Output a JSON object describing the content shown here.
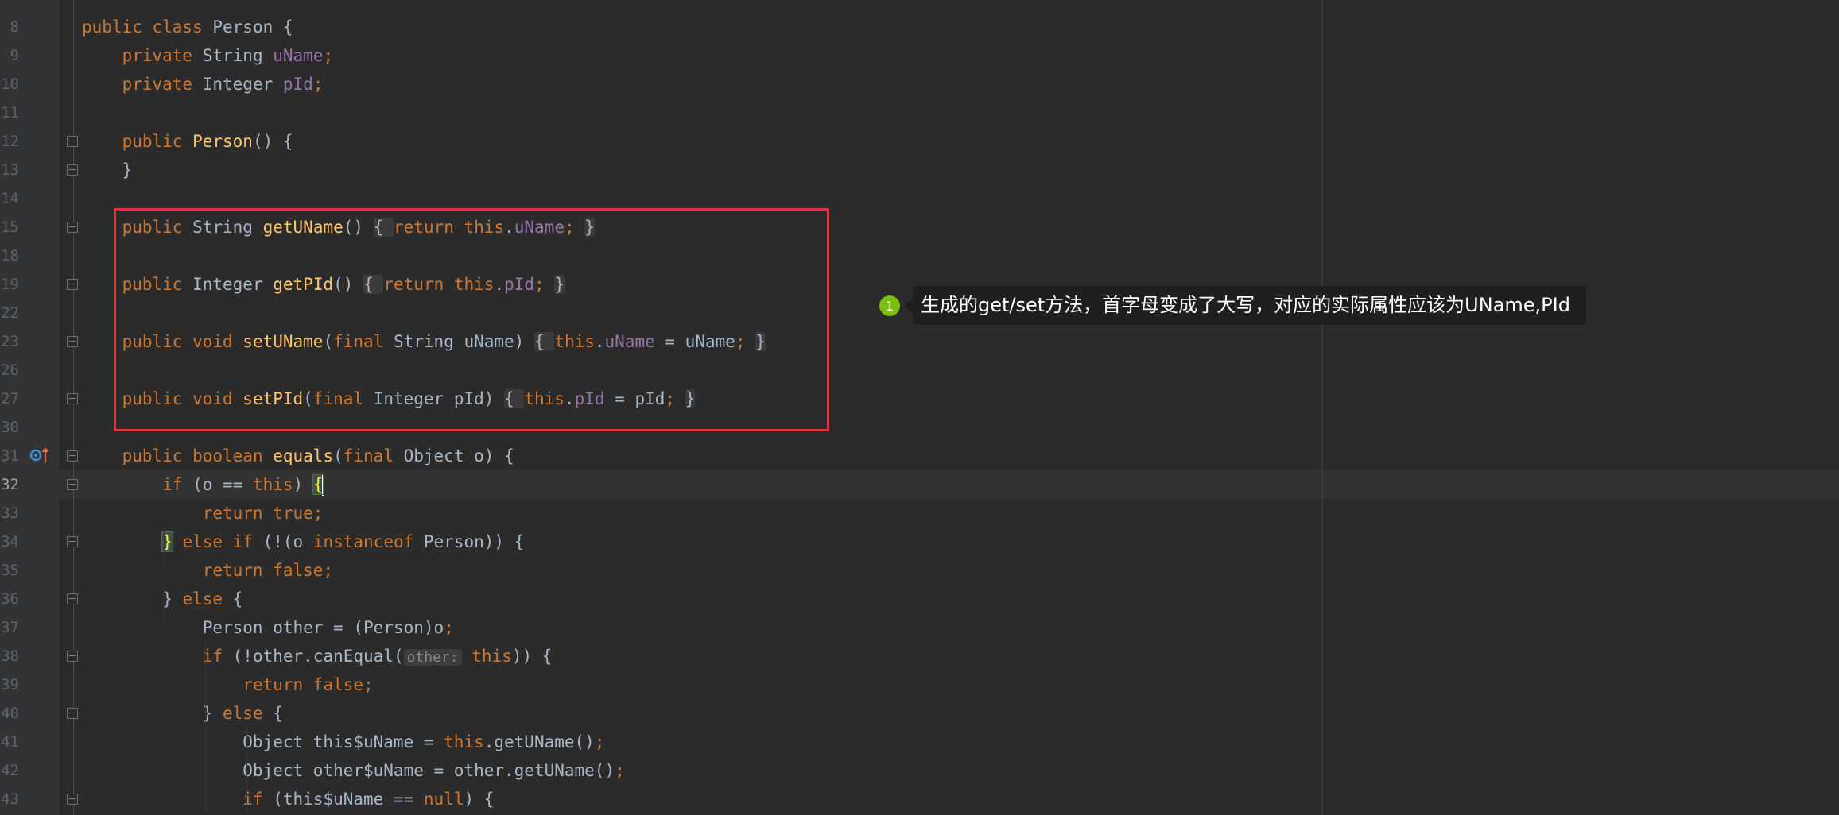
{
  "editor": {
    "lines": [
      {
        "num": "8",
        "current": false,
        "tokens": [
          {
            "t": "kw",
            "v": "public class "
          },
          {
            "t": "plain",
            "v": "Person {"
          }
        ]
      },
      {
        "num": "9",
        "current": false,
        "tokens": [
          {
            "t": "plain",
            "v": "    "
          },
          {
            "t": "kw",
            "v": "private "
          },
          {
            "t": "plain",
            "v": "String "
          },
          {
            "t": "field",
            "v": "uName"
          },
          {
            "t": "kw",
            "v": ";"
          }
        ]
      },
      {
        "num": "10",
        "current": false,
        "tokens": [
          {
            "t": "plain",
            "v": "    "
          },
          {
            "t": "kw",
            "v": "private "
          },
          {
            "t": "plain",
            "v": "Integer "
          },
          {
            "t": "field",
            "v": "pId"
          },
          {
            "t": "kw",
            "v": ";"
          }
        ]
      },
      {
        "num": "11",
        "current": false,
        "tokens": []
      },
      {
        "num": "12",
        "current": false,
        "tokens": [
          {
            "t": "plain",
            "v": "    "
          },
          {
            "t": "kw",
            "v": "public "
          },
          {
            "t": "fn",
            "v": "Person"
          },
          {
            "t": "plain",
            "v": "() {"
          }
        ]
      },
      {
        "num": "13",
        "current": false,
        "tokens": [
          {
            "t": "plain",
            "v": "    }"
          }
        ]
      },
      {
        "num": "14",
        "current": false,
        "tokens": []
      },
      {
        "num": "15",
        "current": false,
        "tokens": [
          {
            "t": "plain",
            "v": "    "
          },
          {
            "t": "kw",
            "v": "public "
          },
          {
            "t": "plain",
            "v": "String "
          },
          {
            "t": "fn",
            "v": "getUName"
          },
          {
            "t": "plain",
            "v": "()"
          },
          {
            "t": "plain",
            "v": " "
          },
          {
            "t": "fold",
            "v": "{ "
          },
          {
            "t": "kw",
            "v": "return this"
          },
          {
            "t": "plain",
            "v": "."
          },
          {
            "t": "field",
            "v": "uName"
          },
          {
            "t": "kw",
            "v": ";"
          },
          {
            "t": "plain",
            "v": " "
          },
          {
            "t": "fold",
            "v": "}"
          }
        ]
      },
      {
        "num": "18",
        "current": false,
        "tokens": []
      },
      {
        "num": "19",
        "current": false,
        "tokens": [
          {
            "t": "plain",
            "v": "    "
          },
          {
            "t": "kw",
            "v": "public "
          },
          {
            "t": "plain",
            "v": "Integer "
          },
          {
            "t": "fn",
            "v": "getPId"
          },
          {
            "t": "plain",
            "v": "()"
          },
          {
            "t": "plain",
            "v": " "
          },
          {
            "t": "fold",
            "v": "{ "
          },
          {
            "t": "kw",
            "v": "return this"
          },
          {
            "t": "plain",
            "v": "."
          },
          {
            "t": "field",
            "v": "pId"
          },
          {
            "t": "kw",
            "v": ";"
          },
          {
            "t": "plain",
            "v": " "
          },
          {
            "t": "fold",
            "v": "}"
          }
        ]
      },
      {
        "num": "22",
        "current": false,
        "tokens": []
      },
      {
        "num": "23",
        "current": false,
        "tokens": [
          {
            "t": "plain",
            "v": "    "
          },
          {
            "t": "kw",
            "v": "public void "
          },
          {
            "t": "fn",
            "v": "setUName"
          },
          {
            "t": "plain",
            "v": "("
          },
          {
            "t": "kw",
            "v": "final "
          },
          {
            "t": "plain",
            "v": "String uName)"
          },
          {
            "t": "plain",
            "v": " "
          },
          {
            "t": "fold",
            "v": "{ "
          },
          {
            "t": "kw",
            "v": "this"
          },
          {
            "t": "plain",
            "v": "."
          },
          {
            "t": "field",
            "v": "uName"
          },
          {
            "t": "plain",
            "v": " = uName"
          },
          {
            "t": "kw",
            "v": ";"
          },
          {
            "t": "plain",
            "v": " "
          },
          {
            "t": "fold",
            "v": "}"
          }
        ]
      },
      {
        "num": "26",
        "current": false,
        "tokens": []
      },
      {
        "num": "27",
        "current": false,
        "tokens": [
          {
            "t": "plain",
            "v": "    "
          },
          {
            "t": "kw",
            "v": "public void "
          },
          {
            "t": "fn",
            "v": "setPId"
          },
          {
            "t": "plain",
            "v": "("
          },
          {
            "t": "kw",
            "v": "final "
          },
          {
            "t": "plain",
            "v": "Integer pId)"
          },
          {
            "t": "plain",
            "v": " "
          },
          {
            "t": "fold",
            "v": "{ "
          },
          {
            "t": "kw",
            "v": "this"
          },
          {
            "t": "plain",
            "v": "."
          },
          {
            "t": "field",
            "v": "pId"
          },
          {
            "t": "plain",
            "v": " = pId"
          },
          {
            "t": "kw",
            "v": ";"
          },
          {
            "t": "plain",
            "v": " "
          },
          {
            "t": "fold",
            "v": "}"
          }
        ]
      },
      {
        "num": "30",
        "current": false,
        "tokens": []
      },
      {
        "num": "31",
        "current": false,
        "tokens": [
          {
            "t": "plain",
            "v": "    "
          },
          {
            "t": "kw",
            "v": "public boolean "
          },
          {
            "t": "fn",
            "v": "equals"
          },
          {
            "t": "plain",
            "v": "("
          },
          {
            "t": "kw",
            "v": "final "
          },
          {
            "t": "plain",
            "v": "Object o) {"
          }
        ]
      },
      {
        "num": "32",
        "current": true,
        "tokens": [
          {
            "t": "plain",
            "v": "        "
          },
          {
            "t": "kw",
            "v": "if "
          },
          {
            "t": "plain",
            "v": "(o == "
          },
          {
            "t": "kw",
            "v": "this"
          },
          {
            "t": "plain",
            "v": ") "
          },
          {
            "t": "brace",
            "v": "{"
          },
          {
            "t": "caret",
            "v": ""
          }
        ]
      },
      {
        "num": "33",
        "current": false,
        "tokens": [
          {
            "t": "plain",
            "v": "            "
          },
          {
            "t": "kw",
            "v": "return true;"
          }
        ]
      },
      {
        "num": "34",
        "current": false,
        "tokens": [
          {
            "t": "plain",
            "v": "        "
          },
          {
            "t": "brace",
            "v": "}"
          },
          {
            "t": "kw",
            "v": " else if "
          },
          {
            "t": "plain",
            "v": "(!(o "
          },
          {
            "t": "kw",
            "v": "instanceof "
          },
          {
            "t": "plain",
            "v": "Person)) {"
          }
        ]
      },
      {
        "num": "35",
        "current": false,
        "tokens": [
          {
            "t": "plain",
            "v": "            "
          },
          {
            "t": "kw",
            "v": "return false;"
          }
        ]
      },
      {
        "num": "36",
        "current": false,
        "tokens": [
          {
            "t": "plain",
            "v": "        } "
          },
          {
            "t": "kw",
            "v": "else "
          },
          {
            "t": "plain",
            "v": "{"
          }
        ]
      },
      {
        "num": "37",
        "current": false,
        "tokens": [
          {
            "t": "plain",
            "v": "            Person other = (Person)o"
          },
          {
            "t": "kw",
            "v": ";"
          }
        ]
      },
      {
        "num": "38",
        "current": false,
        "tokens": [
          {
            "t": "plain",
            "v": "            "
          },
          {
            "t": "kw",
            "v": "if "
          },
          {
            "t": "plain",
            "v": "(!other.canEqual("
          },
          {
            "t": "hint",
            "v": "other:"
          },
          {
            "t": "plain",
            "v": " "
          },
          {
            "t": "kw",
            "v": "this"
          },
          {
            "t": "plain",
            "v": ")) {"
          }
        ]
      },
      {
        "num": "39",
        "current": false,
        "tokens": [
          {
            "t": "plain",
            "v": "                "
          },
          {
            "t": "kw",
            "v": "return false;"
          }
        ]
      },
      {
        "num": "40",
        "current": false,
        "tokens": [
          {
            "t": "plain",
            "v": "            } "
          },
          {
            "t": "kw",
            "v": "else "
          },
          {
            "t": "plain",
            "v": "{"
          }
        ]
      },
      {
        "num": "41",
        "current": false,
        "tokens": [
          {
            "t": "plain",
            "v": "                Object this$uName = "
          },
          {
            "t": "kw",
            "v": "this"
          },
          {
            "t": "plain",
            "v": ".getUName()"
          },
          {
            "t": "kw",
            "v": ";"
          }
        ]
      },
      {
        "num": "42",
        "current": false,
        "tokens": [
          {
            "t": "plain",
            "v": "                Object other$uName = other.getUName()"
          },
          {
            "t": "kw",
            "v": ";"
          }
        ]
      },
      {
        "num": "43",
        "current": false,
        "tokens": [
          {
            "t": "plain",
            "v": "                "
          },
          {
            "t": "kw",
            "v": "if "
          },
          {
            "t": "plain",
            "v": "(this$uName == "
          },
          {
            "t": "kw",
            "v": "null"
          },
          {
            "t": "plain",
            "v": ") {"
          }
        ]
      }
    ]
  },
  "annotation": {
    "badge": "1",
    "text": "生成的get/set方法，首字母变成了大写，对应的实际属性应该为UName,PId",
    "box_color": "#d9363e",
    "badge_color": "#7dbd0f"
  },
  "icons": {
    "override": "override-method-icon",
    "fold": "fold-marker-icon"
  }
}
